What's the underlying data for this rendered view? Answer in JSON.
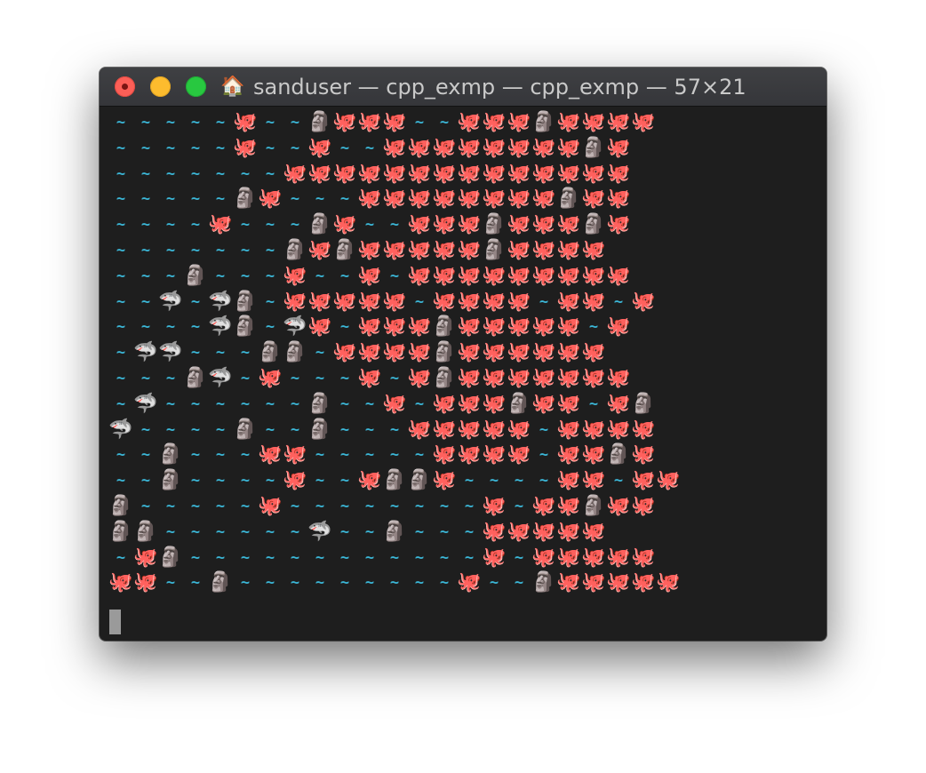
{
  "window": {
    "title": "sanduser — cpp_exmp — cpp_exmp — 57×21",
    "home_icon": "🏠"
  },
  "glyph_key": {
    "~": "~",
    "O": "🐙",
    "M": "🗿",
    "S": "🦈"
  },
  "terminal": {
    "rows": [
      "~~~~~O~~MOOO~~OOOMOOOO",
      "~~~~~O~~O~~OOOOOOOOMO",
      "~~~~~~~OOOOOOOOOOOOOO",
      "~~~~~MO~~~OOOOOOOOMOO",
      "~~~~O~~~MO~~OOOMOOOMO",
      "~~~~~~~MOMOOOOOMOOOO",
      "~~~M~~~O~~O~OOOOOOOOO",
      "~~S~SM~OOOOO~OOOO~OO~O",
      "~~~~SM~SO~OOOMOOOOO~O",
      "~SS~~~MM~OOOOMOOOOOO",
      "~~~MS~O~~~O~OMOOOOOOO",
      "~S~~~~~~M~~O~OOOMOO~OM",
      "S~~~~M~~M~~~OOOOO~OOOO",
      "~~M~~~OO~~~~~OOOO~OOMO",
      "~~M~~~~O~~OMMO~~~~OO~OO",
      "M~~~~~O~~~~~~~~O~OOMOO",
      "MM~~~~~~S~~M~~~OOOOO",
      "~OM~~~~~~~~~~~~O~OOOOO",
      "OO~~M~~~~~~~~~O~~MOOOOO"
    ]
  }
}
